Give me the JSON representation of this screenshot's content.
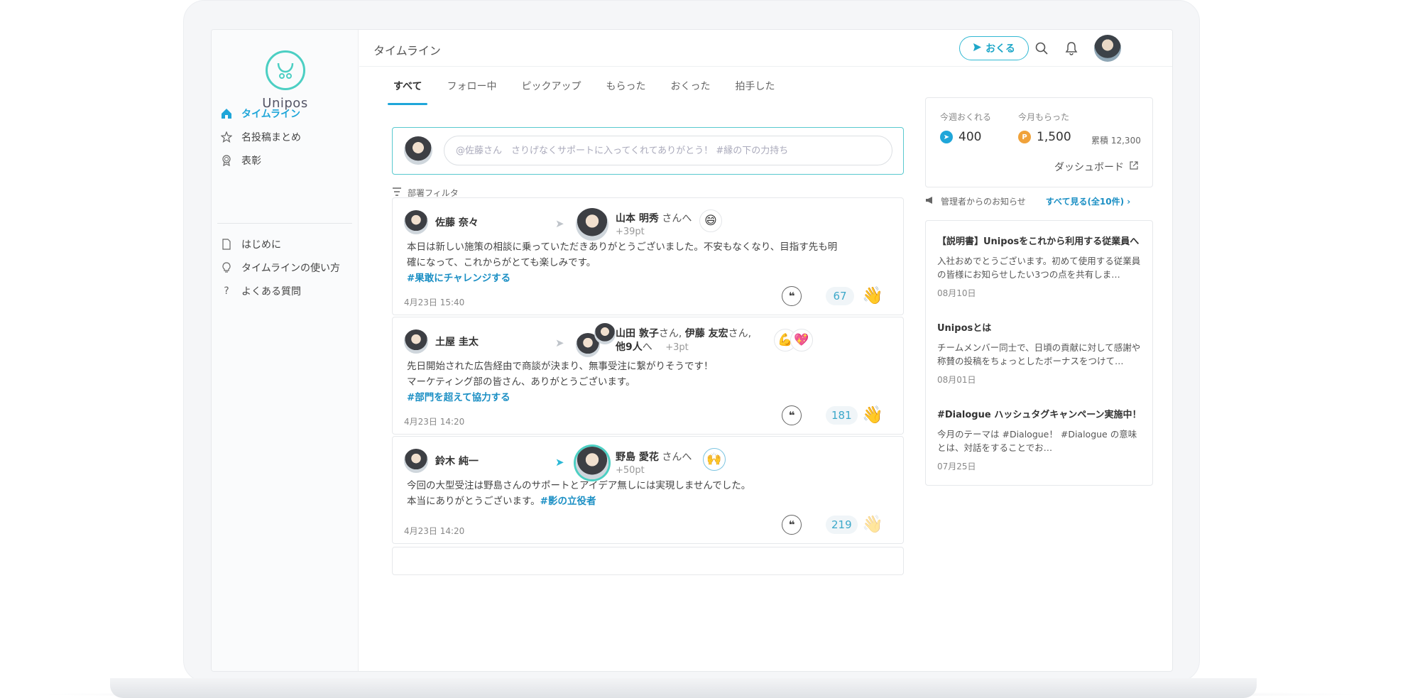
{
  "app": {
    "name": "Unipos"
  },
  "sidebar": {
    "items": [
      {
        "label": "タイムライン",
        "icon": "home-icon"
      },
      {
        "label": "名投稿まとめ",
        "icon": "star-icon"
      },
      {
        "label": "表彰",
        "icon": "award-icon"
      },
      {
        "label": "はじめに",
        "icon": "document-icon"
      },
      {
        "label": "タイムラインの使い方",
        "icon": "lightbulb-icon"
      },
      {
        "label": "よくある質問",
        "icon": "question-icon"
      }
    ]
  },
  "header": {
    "title": "タイムライン",
    "send_label": "おくる"
  },
  "tabs": [
    "すべて",
    "フォロー中",
    "ピックアップ",
    "もらった",
    "おくった",
    "拍手した"
  ],
  "compose": {
    "placeholder": "@佐藤さん　さりげなくサポートに入ってくれてありがとう！ #縁の下の力持ち"
  },
  "filter_label": "部署フィルタ",
  "posts": [
    {
      "sender": "佐藤 奈々",
      "receiver": "山本 明秀",
      "receiver_suffix": "さんへ",
      "points": "+39pt",
      "stamp": "😄",
      "body_lines": [
        "本日は新しい施策の相談に乗っていただきありがとうございました。不安もなくなり、目指す先も明",
        "確になって、これからがとても楽しみです。"
      ],
      "hashtag": "#果敢にチャレンジする",
      "timestamp": "4月23日 15:40",
      "claps": "67"
    },
    {
      "sender": "土屋 圭太",
      "receiver": "山田 敦子",
      "receiver_suffix": "さん,",
      "receiver2": "伊藤 友宏",
      "receiver2_suffix": "さん,",
      "receiver_more": "他9人",
      "receiver_more_suffix": "へ",
      "points": "+3pt",
      "stamp": "💪",
      "stamp2": "💖",
      "body_lines": [
        "先日開始された広告経由で商談が決まり、無事受注に繋がりそうです！",
        "マーケティング部の皆さん、ありがとうございます。"
      ],
      "hashtag": "#部門を超えて協力する",
      "timestamp": "4月23日 14:20",
      "claps": "181"
    },
    {
      "sender": "鈴木 純一",
      "receiver": "野島 愛花",
      "receiver_suffix": "さんへ",
      "points": "+50pt",
      "stamp": "🙌",
      "body_lines": [
        "今回の大型受注は野島さんのサポートとアイデア無しには実現しませんでした。",
        "本当にありがとうございます。"
      ],
      "hashtag": "#影の立役者",
      "timestamp": "4月23日 14:20",
      "claps": "219"
    }
  ],
  "stats": {
    "send_label": "今週おくれる",
    "send_value": "400",
    "recv_label": "今月もらった",
    "recv_value": "1,500",
    "cumulative_label": "累積",
    "cumulative_value": "12,300",
    "dashboard_label": "ダッシュボード"
  },
  "notices_header": {
    "label": "管理者からのお知らせ",
    "see_all": "すべて見る(全10件)"
  },
  "notices": [
    {
      "title": "【説明書】Uniposをこれから利用する従業員へ",
      "body": "入社おめでとうございます。初めて使用する従業員の皆様にお知らせしたい3つの点を共有しま…",
      "date": "08月10日"
    },
    {
      "title": "Uniposとは",
      "body": "チームメンバー同士で、日頃の貢献に対して感謝や称賛の投稿をちょっとしたボーナスをつけて…",
      "date": "08月01日"
    },
    {
      "title": "#Dialogue ハッシュタグキャンペーン実施中！",
      "body": "今月のテーマは #Dialogue！ #Dialogue の意味とは、対話をすることでお…",
      "date": "07月25日"
    }
  ],
  "colors": {
    "accent": "#1fa6d9",
    "brand_teal": "#4ccfc3",
    "send_dot": "#1fa6d9",
    "recv_dot": "#f0a23a"
  }
}
